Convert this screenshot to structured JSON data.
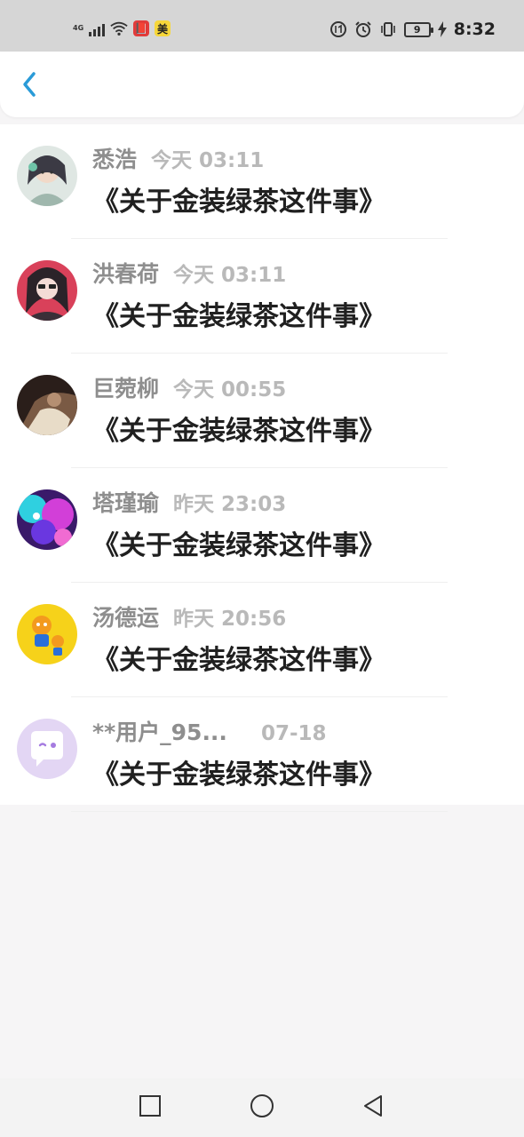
{
  "status_bar": {
    "network_label": "4G",
    "app_badge_red": "📕",
    "app_badge_yellow": "美",
    "battery_level": "9",
    "time": "8:32"
  },
  "header": {
    "back_icon": "chevron-left-icon",
    "accent_color": "#2a9bd8"
  },
  "messages": [
    {
      "name": "悉浩",
      "time": "今天 03:11",
      "text": "《关于金装绿茶这件事》",
      "avatar": "anime-portrait"
    },
    {
      "name": "洪春荷",
      "time": "今天 03:11",
      "text": "《关于金装绿茶这件事》",
      "avatar": "anime-girl-red"
    },
    {
      "name": "巨菀柳",
      "time": "今天 00:55",
      "text": "《关于金装绿茶这件事》",
      "avatar": "dark-photo"
    },
    {
      "name": "塔瑾瑜",
      "time": "昨天 23:03",
      "text": "《关于金装绿茶这件事》",
      "avatar": "galaxy-colorful"
    },
    {
      "name": "汤德运",
      "time": "昨天 20:56",
      "text": "《关于金装绿茶这件事》",
      "avatar": "orange-characters-yellow"
    },
    {
      "name": "**用户_95...",
      "time": "07-18",
      "text": "《关于金装绿茶这件事》",
      "avatar": "default-chat-bubble"
    }
  ],
  "nav_bar": {
    "recent_icon": "square-icon",
    "home_icon": "circle-icon",
    "back_icon": "triangle-back-icon"
  }
}
